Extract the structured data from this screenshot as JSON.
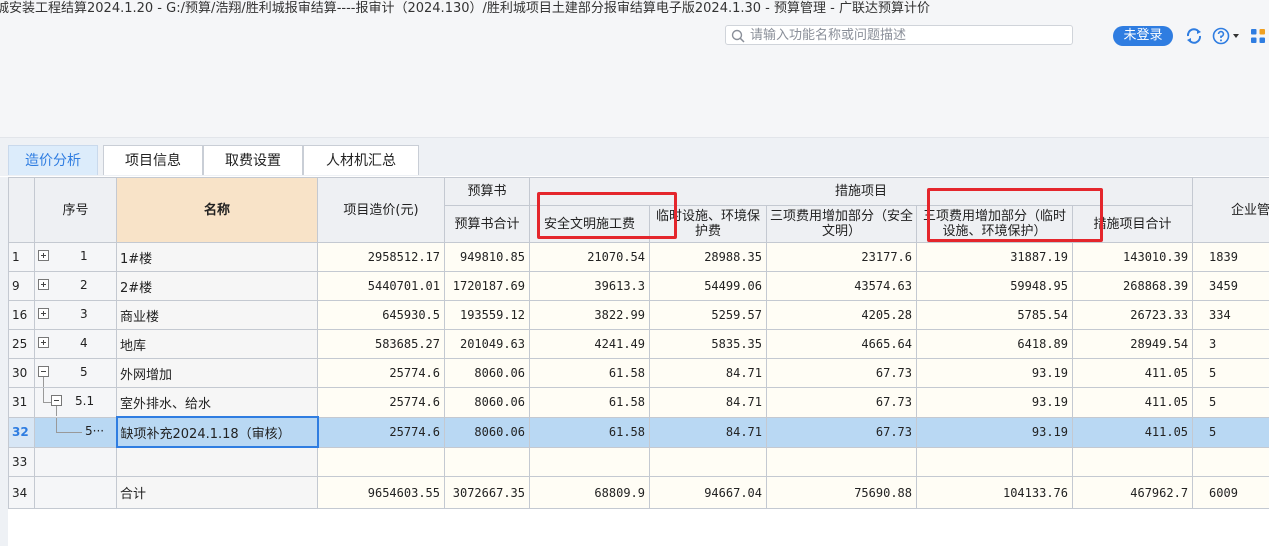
{
  "window": {
    "title": "城安装工程结算2024.1.20 - G:/预算/浩翔/胜利城报审结算----报审计（2024.130）/胜利城项目土建部分报审结算电子版2024.1.30 - 预算管理 - 广联达预算计价"
  },
  "toolbar": {
    "search_placeholder": "请输入功能名称或问题描述",
    "login_label": "未登录"
  },
  "icons": {
    "search": "search-icon",
    "sync": "sync-icon",
    "help": "help-icon",
    "apps": "apps-grid-icon",
    "expand": "plus-square-icon",
    "collapse": "minus-square-icon"
  },
  "colors": {
    "accent": "#2f7de1",
    "highlight_box": "#e4262c",
    "selected_row": "#b9d8f3",
    "name_header": "#f8e3c8"
  },
  "tabs": [
    {
      "label": "造价分析",
      "active": true
    },
    {
      "label": "项目信息",
      "active": false
    },
    {
      "label": "取费设置",
      "active": false
    },
    {
      "label": "人材机汇总",
      "active": false
    }
  ],
  "table": {
    "headers": {
      "seq": "序号",
      "name": "名称",
      "cost": "项目造价(元)",
      "budget_group": "预算书",
      "budget_total": "预算书合计",
      "measures_group": "措施项目",
      "safety": "安全文明施工费",
      "temp": "临时设施、环境保护费",
      "three_safety": "三项费用增加部分（安全文明）",
      "three_temp": "三项费用增加部分（临时设施、环境保护）",
      "measures_total": "措施项目合计",
      "enterprise": "企业管"
    },
    "rows": [
      {
        "rownum": "1",
        "toggle": "plus",
        "seq": "1",
        "name": "1#楼",
        "cost": "2958512.17",
        "budget": "949810.85",
        "safety": "21070.54",
        "temp": "28988.35",
        "three_safety": "23177.6",
        "three_temp": "31887.19",
        "measures": "143010.39",
        "enterprise": "1839"
      },
      {
        "rownum": "9",
        "toggle": "plus",
        "seq": "2",
        "name": "2#楼",
        "cost": "5440701.01",
        "budget": "1720187.69",
        "safety": "39613.3",
        "temp": "54499.06",
        "three_safety": "43574.63",
        "three_temp": "59948.95",
        "measures": "268868.39",
        "enterprise": "3459"
      },
      {
        "rownum": "16",
        "toggle": "plus",
        "seq": "3",
        "name": "商业楼",
        "cost": "645930.5",
        "budget": "193559.12",
        "safety": "3822.99",
        "temp": "5259.57",
        "three_safety": "4205.28",
        "three_temp": "5785.54",
        "measures": "26723.33",
        "enterprise": "334"
      },
      {
        "rownum": "25",
        "toggle": "plus",
        "seq": "4",
        "name": "地库",
        "cost": "583685.27",
        "budget": "201049.63",
        "safety": "4241.49",
        "temp": "5835.35",
        "three_safety": "4665.64",
        "three_temp": "6418.89",
        "measures": "28949.54",
        "enterprise": "3"
      },
      {
        "rownum": "30",
        "toggle": "minus",
        "seq": "5",
        "name": "外网增加",
        "cost": "25774.6",
        "budget": "8060.06",
        "safety": "61.58",
        "temp": "84.71",
        "three_safety": "67.73",
        "three_temp": "93.19",
        "measures": "411.05",
        "enterprise": "5"
      },
      {
        "rownum": "31",
        "toggle": "minus",
        "seq": "5.1",
        "name": "室外排水、给水",
        "cost": "25774.6",
        "budget": "8060.06",
        "safety": "61.58",
        "temp": "84.71",
        "three_safety": "67.73",
        "three_temp": "93.19",
        "measures": "411.05",
        "enterprise": "5"
      },
      {
        "rownum": "32",
        "toggle": "",
        "seq": "5···",
        "name": "缺项补充2024.1.18（审核）",
        "cost": "25774.6",
        "budget": "8060.06",
        "safety": "61.58",
        "temp": "84.71",
        "three_safety": "67.73",
        "three_temp": "93.19",
        "measures": "411.05",
        "enterprise": "5"
      },
      {
        "rownum": "33",
        "toggle": "",
        "seq": "",
        "name": "",
        "cost": "",
        "budget": "",
        "safety": "",
        "temp": "",
        "three_safety": "",
        "three_temp": "",
        "measures": "",
        "enterprise": ""
      },
      {
        "rownum": "34",
        "toggle": "",
        "seq": "",
        "name": "合计",
        "cost": "9654603.55",
        "budget": "3072667.35",
        "safety": "68809.9",
        "temp": "94667.04",
        "three_safety": "75690.88",
        "three_temp": "104133.76",
        "measures": "467962.7",
        "enterprise": "6009"
      }
    ]
  }
}
